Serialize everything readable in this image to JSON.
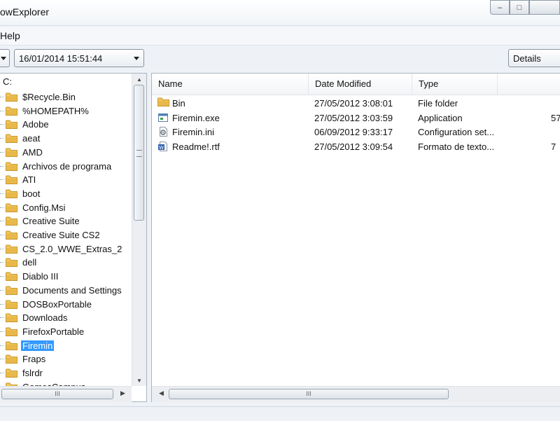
{
  "window": {
    "title": "owExplorer",
    "buttons": {
      "minimize": "–",
      "maximize": "□",
      "close": ""
    }
  },
  "menu": {
    "items": [
      {
        "label": "Help"
      }
    ]
  },
  "toolbar": {
    "date_value": "16/01/2014 15:51:44",
    "view_value": "Details"
  },
  "tree": {
    "root_label": "C:",
    "selected": "Firemin",
    "items": [
      "$Recycle.Bin",
      "%HOMEPATH%",
      "Adobe",
      "aeat",
      "AMD",
      "Archivos de programa",
      "ATI",
      "boot",
      "Config.Msi",
      "Creative Suite",
      "Creative Suite CS2",
      "CS_2.0_WWE_Extras_2",
      "dell",
      "Diablo III",
      "Documents and Settings",
      "DOSBoxPortable",
      "Downloads",
      "FirefoxPortable",
      "Firemin",
      "Fraps",
      "fslrdr",
      "GamesCampus"
    ],
    "scroll_grip": "≡",
    "hscroll_grip": "III"
  },
  "list": {
    "columns": [
      "Name",
      "Date Modified",
      "Type",
      ""
    ],
    "rows": [
      {
        "icon": "folder-icon",
        "name": "Bin",
        "date": "27/05/2012 3:08:01",
        "type": "File folder",
        "size": ""
      },
      {
        "icon": "exe-icon",
        "name": "Firemin.exe",
        "date": "27/05/2012 3:03:59",
        "type": "Application",
        "size": "57"
      },
      {
        "icon": "ini-icon",
        "name": "Firemin.ini",
        "date": "06/09/2012 9:33:17",
        "type": "Configuration set...",
        "size": ""
      },
      {
        "icon": "rtf-icon",
        "name": "Readme!.rtf",
        "date": "27/05/2012 3:09:54",
        "type": "Formato de texto...",
        "size": "7"
      }
    ],
    "hscroll_grip": "III"
  },
  "colors": {
    "selection": "#3399ff",
    "folder": "#e8b84a",
    "border": "#a9b3bf"
  }
}
